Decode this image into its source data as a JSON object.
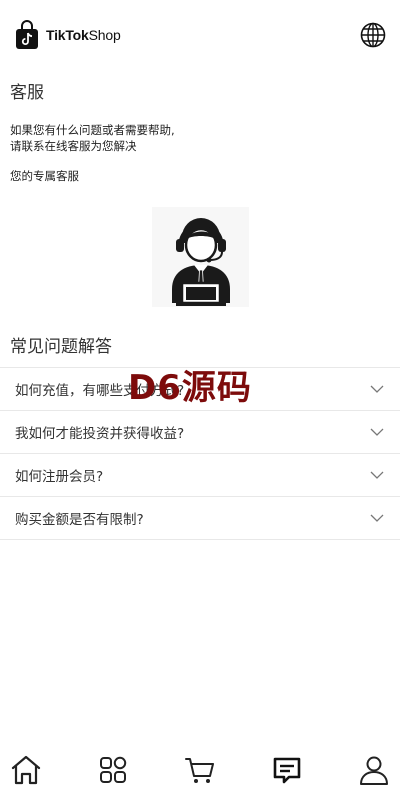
{
  "header": {
    "brand_bold": "TikTok",
    "brand_light": "Shop",
    "logo_icon": "tiktok-shop-bag-icon",
    "language_icon": "globe-icon"
  },
  "customer_service": {
    "title": "客服",
    "desc_line1": "如果您有什么问题或者需要帮助,",
    "desc_line2": "请联系在线客服为您解决",
    "exclusive": "您的专属客服",
    "agent_icon": "customer-service-agent-icon"
  },
  "faq": {
    "title": "常见问题解答",
    "items": [
      {
        "question": "如何充值，有哪些支付方式?"
      },
      {
        "question": "我如何才能投资并获得收益?"
      },
      {
        "question": "如何注册会员?"
      },
      {
        "question": "购买金额是否有限制?"
      }
    ]
  },
  "watermark": "D6源码",
  "tabbar": {
    "items": [
      {
        "icon": "home-icon",
        "active": false
      },
      {
        "icon": "grid-icon",
        "active": false
      },
      {
        "icon": "cart-icon",
        "active": false
      },
      {
        "icon": "message-icon",
        "active": true
      },
      {
        "icon": "user-icon",
        "active": false
      }
    ]
  },
  "colors": {
    "watermark": "#7d0b0b",
    "divider": "#e8e8e8",
    "text": "#333333"
  }
}
